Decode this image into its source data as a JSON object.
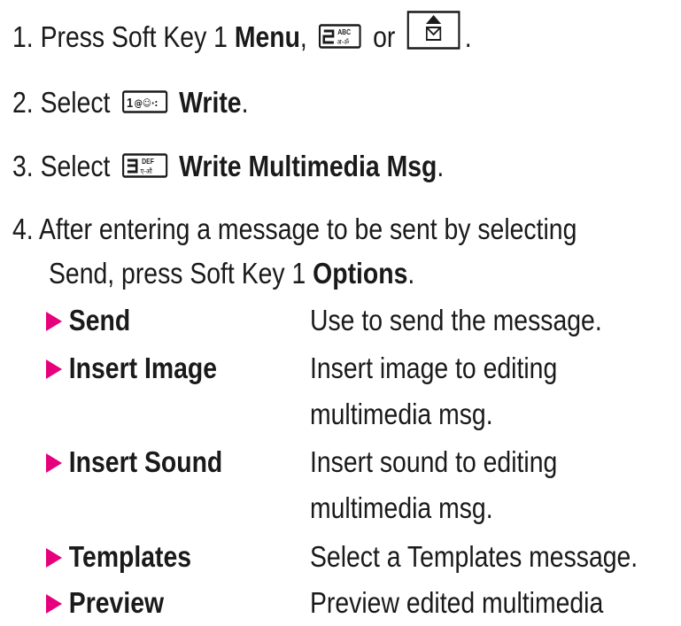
{
  "steps": [
    {
      "number": "1.",
      "text_before": "Press Soft Key 1",
      "bold": "Menu",
      "sep": ",",
      "or": "or",
      "end": ".",
      "key1_main": "2",
      "key1_top": "ABC",
      "key1_bottom": "अ-ॐ"
    },
    {
      "number": "2.",
      "text_before": "Select",
      "key_main": "1",
      "key_glyphs": "@☺·:",
      "bold": "Write",
      "end": "."
    },
    {
      "number": "3.",
      "text_before": "Select",
      "key_main": "3",
      "key_top": "DEF",
      "key_bottom": "ए-औ",
      "bold": "Write Multimedia Msg",
      "end": "."
    },
    {
      "number": "4.",
      "line1": "After entering a message to be sent by selecting",
      "line2_before": "Send, press Soft Key 1",
      "bold": "Options",
      "end": "."
    }
  ],
  "options": [
    {
      "name": "Send",
      "desc": [
        "Use to send the message."
      ]
    },
    {
      "name": "Insert Image",
      "desc": [
        "Insert image to editing",
        "multimedia msg."
      ]
    },
    {
      "name": "Insert Sound",
      "desc": [
        "Insert sound to editing",
        "multimedia msg."
      ]
    },
    {
      "name": "Templates",
      "desc": [
        "Select a Templates message."
      ]
    },
    {
      "name": "Preview",
      "desc": [
        "Preview edited multimedia"
      ]
    }
  ],
  "colors": {
    "bullet": "#e6007e",
    "text": "#1a1a1a"
  },
  "icons": {
    "key_2": "key-2-abc-icon",
    "envelope_key": "message-envelope-key-icon",
    "key_1": "key-1-symbols-icon",
    "key_3": "key-3-def-icon",
    "bullet": "triangle-bullet-icon"
  }
}
